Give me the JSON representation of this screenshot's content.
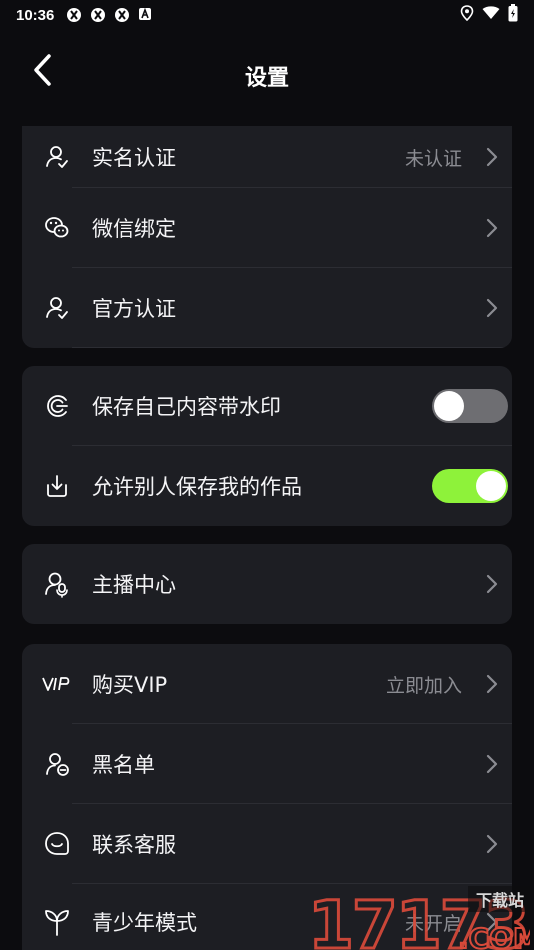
{
  "status_bar": {
    "time": "10:36",
    "notification_icons": [
      "app-notification-icon",
      "app-notification-icon",
      "app-notification-icon",
      "a-notification-icon"
    ],
    "right_icons": [
      "location-icon",
      "wifi-icon",
      "battery-icon"
    ]
  },
  "header": {
    "title": "设置",
    "back_icon": "chevron-left-icon"
  },
  "sections": [
    {
      "rows": [
        {
          "label": "实名认证",
          "value": "未认证",
          "icon": "user-verify-icon",
          "chevron": true
        },
        {
          "label": "微信绑定",
          "value": "",
          "icon": "wechat-icon",
          "chevron": true
        },
        {
          "label": "官方认证",
          "value": "",
          "icon": "user-official-icon",
          "chevron": true
        }
      ]
    },
    {
      "rows": [
        {
          "label": "保存自己内容带水印",
          "icon": "watermark-icon",
          "toggle": "off"
        },
        {
          "label": "允许别人保存我的作品",
          "icon": "download-icon",
          "toggle": "on"
        }
      ]
    },
    {
      "rows": [
        {
          "label": "主播中心",
          "value": "",
          "icon": "streamer-icon",
          "chevron": true
        }
      ]
    },
    {
      "rows": [
        {
          "label": "购买VIP",
          "value": "立即加入",
          "icon": "vip-icon",
          "chevron": true
        },
        {
          "label": "黑名单",
          "value": "",
          "icon": "blacklist-icon",
          "chevron": true
        },
        {
          "label": "联系客服",
          "value": "",
          "icon": "customer-service-icon",
          "chevron": true
        },
        {
          "label": "青少年模式",
          "value": "未开启",
          "icon": "sprout-icon",
          "chevron": true
        }
      ]
    }
  ],
  "watermark": {
    "number": "17173",
    "top_text": "下载站",
    "domain": ".COM"
  },
  "colors": {
    "background": "#0c0c0f",
    "card": "#1d1e23",
    "toggle_on": "#8ef23a",
    "toggle_off": "#6e6e72",
    "watermark": "#d33b2f"
  }
}
